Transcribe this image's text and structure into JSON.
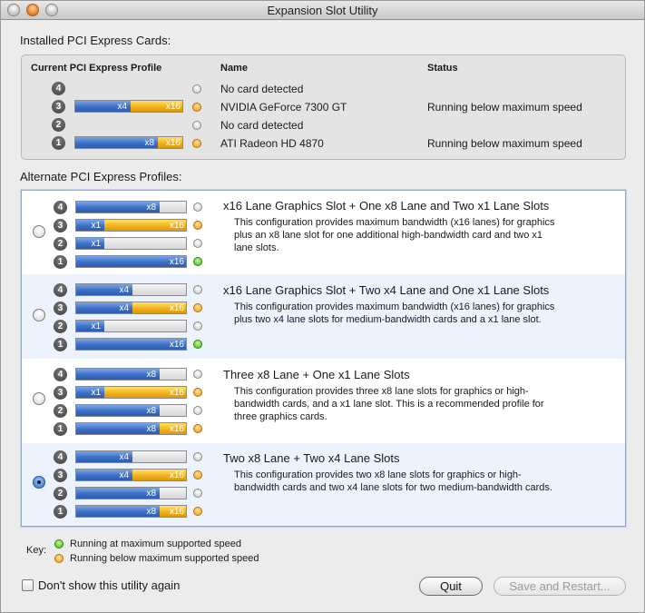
{
  "window": {
    "title": "Expansion Slot Utility"
  },
  "installed": {
    "section_label": "Installed PCI Express Cards:",
    "headers": {
      "profile": "Current PCI Express Profile",
      "name": "Name",
      "status": "Status"
    },
    "rows": [
      {
        "slot": "4",
        "name": "No card detected",
        "status": ""
      },
      {
        "slot": "3",
        "name": "NVIDIA GeForce 7300 GT",
        "status": "Running below maximum speed"
      },
      {
        "slot": "2",
        "name": "No card detected",
        "status": ""
      },
      {
        "slot": "1",
        "name": "ATI Radeon HD 4870",
        "status": "Running below maximum speed"
      }
    ]
  },
  "alternate": {
    "section_label": "Alternate PCI Express Profiles:",
    "profiles": [
      {
        "title": "x16 Lane Graphics Slot + One x8 Lane and Two x1 Lane Slots",
        "desc1": "This configuration provides maximum bandwidth (x16 lanes) for graphics",
        "desc2": "plus an x8 lane slot for one additional high-bandwidth card and two x1",
        "desc3": "lane slots.",
        "selected": false,
        "slots": [
          "4",
          "3",
          "2",
          "1"
        ],
        "lanes": [
          {
            "blue": "x8",
            "yellow": ""
          },
          {
            "blue": "x1",
            "yellow": "x16"
          },
          {
            "blue": "x1",
            "yellow": ""
          },
          {
            "blue": "x16",
            "yellow": ""
          }
        ]
      },
      {
        "title": "x16 Lane Graphics Slot + Two x4 Lane and One x1 Lane Slots",
        "desc1": "This configuration provides maximum bandwidth (x16 lanes) for graphics",
        "desc2": "plus two x4 lane slots for medium-bandwidth cards and a x1 lane slot.",
        "desc3": "",
        "selected": false,
        "slots": [
          "4",
          "3",
          "2",
          "1"
        ],
        "lanes": [
          {
            "blue": "x4",
            "yellow": ""
          },
          {
            "blue": "x4",
            "yellow": "x16"
          },
          {
            "blue": "x1",
            "yellow": ""
          },
          {
            "blue": "x16",
            "yellow": ""
          }
        ]
      },
      {
        "title": "Three x8 Lane + One x1 Lane Slots",
        "desc1": "This configuration provides three x8 lane slots for graphics or high-",
        "desc2": "bandwidth cards, and a x1 lane slot.  This is a recommended profile for",
        "desc3": "three graphics cards.",
        "selected": false,
        "slots": [
          "4",
          "3",
          "2",
          "1"
        ],
        "lanes": [
          {
            "blue": "x8",
            "yellow": ""
          },
          {
            "blue": "x1",
            "yellow": "x16"
          },
          {
            "blue": "x8",
            "yellow": ""
          },
          {
            "blue": "x8",
            "yellow": "x16"
          }
        ]
      },
      {
        "title": "Two x8 Lane + Two x4 Lane Slots",
        "desc1": "This configuration provides two x8 lane slots for graphics or high-",
        "desc2": "bandwidth cards and two x4 lane slots for two medium-bandwidth cards.",
        "desc3": "",
        "selected": true,
        "slots": [
          "4",
          "3",
          "2",
          "1"
        ],
        "lanes": [
          {
            "blue": "x4",
            "yellow": ""
          },
          {
            "blue": "x4",
            "yellow": "x16"
          },
          {
            "blue": "x8",
            "yellow": ""
          },
          {
            "blue": "x8",
            "yellow": "x16"
          }
        ]
      }
    ]
  },
  "key": {
    "label": "Key:",
    "green": "Running at maximum supported speed",
    "orange": "Running below maximum supported speed",
    "colors": {
      "green": "#3fb81a",
      "orange": "#f29a10"
    }
  },
  "footer": {
    "checkbox_label": "Don't show this utility again",
    "quit_label": "Quit",
    "save_label": "Save and Restart..."
  }
}
